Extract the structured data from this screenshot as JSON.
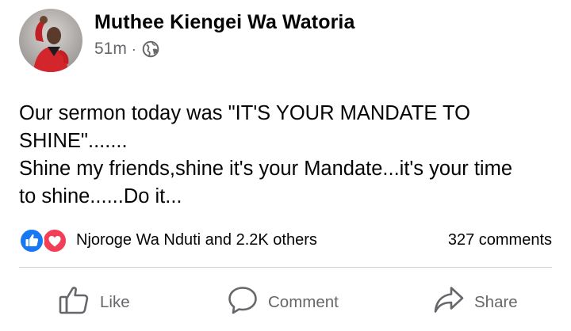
{
  "post": {
    "author": "Muthee Kiengei Wa Watoria",
    "time": "51m",
    "separator": "·",
    "audience_icon": "globe-icon",
    "avatar": "profile-photo"
  },
  "body": {
    "text": "Our sermon today was \"IT'S YOUR MANDATE TO\nSHINE\".......\nShine my friends,shine it's your Mandate...it's your time\nto shine......Do it..."
  },
  "engagement": {
    "reaction_icons": [
      "like-reaction-icon",
      "love-reaction-icon"
    ],
    "reactions_text": "Njoroge Wa Nduti and 2.2K others",
    "comments_text": "327 comments"
  },
  "actions": {
    "like_label": "Like",
    "comment_label": "Comment",
    "share_label": "Share"
  },
  "colors": {
    "like_blue": "#1877f2",
    "love_red": "#f33e58",
    "secondary_text": "#65676b",
    "divider": "#ced0d4"
  }
}
